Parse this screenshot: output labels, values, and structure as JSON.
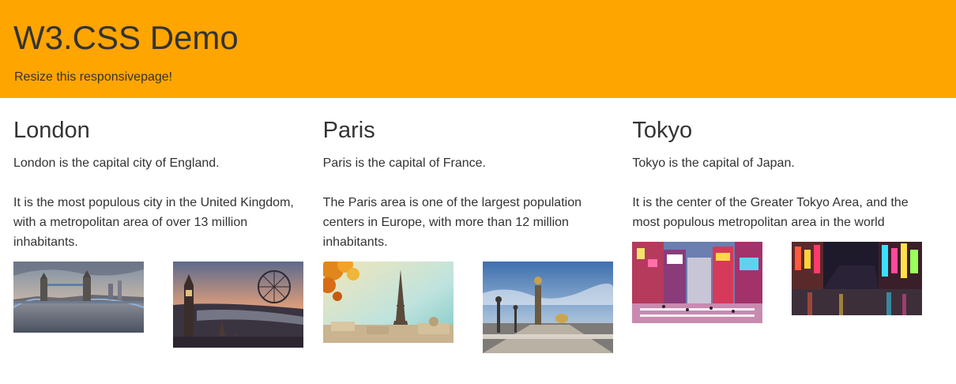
{
  "header": {
    "title": "W3.CSS Demo",
    "subtitle": "Resize this responsivepage!"
  },
  "cities": [
    {
      "name": "London",
      "line1": "London is the capital city of England.",
      "line2": "It is the most populous city in the United Kingdom, with a metropolitan area of over 13 million inhabitants.",
      "photos": [
        "tower-bridge-photo",
        "westminster-london-eye-photo"
      ]
    },
    {
      "name": "Paris",
      "line1": "Paris is the capital of France.",
      "line2": "The Paris area is one of the largest population centers in Europe, with more than 12 million inhabitants.",
      "photos": [
        "eiffel-tower-autumn-photo",
        "pont-alexandre-iii-photo"
      ]
    },
    {
      "name": "Tokyo",
      "line1": "Tokyo is the capital of Japan.",
      "line2": "It is the center of the Greater Tokyo Area, and the most populous metropolitan area in the world",
      "photos": [
        "shibuya-crossing-photo",
        "tokyo-night-street-photo"
      ]
    }
  ],
  "colors": {
    "header_bg": "#ffa500",
    "text": "#333333",
    "page_bg": "#ffffff"
  }
}
